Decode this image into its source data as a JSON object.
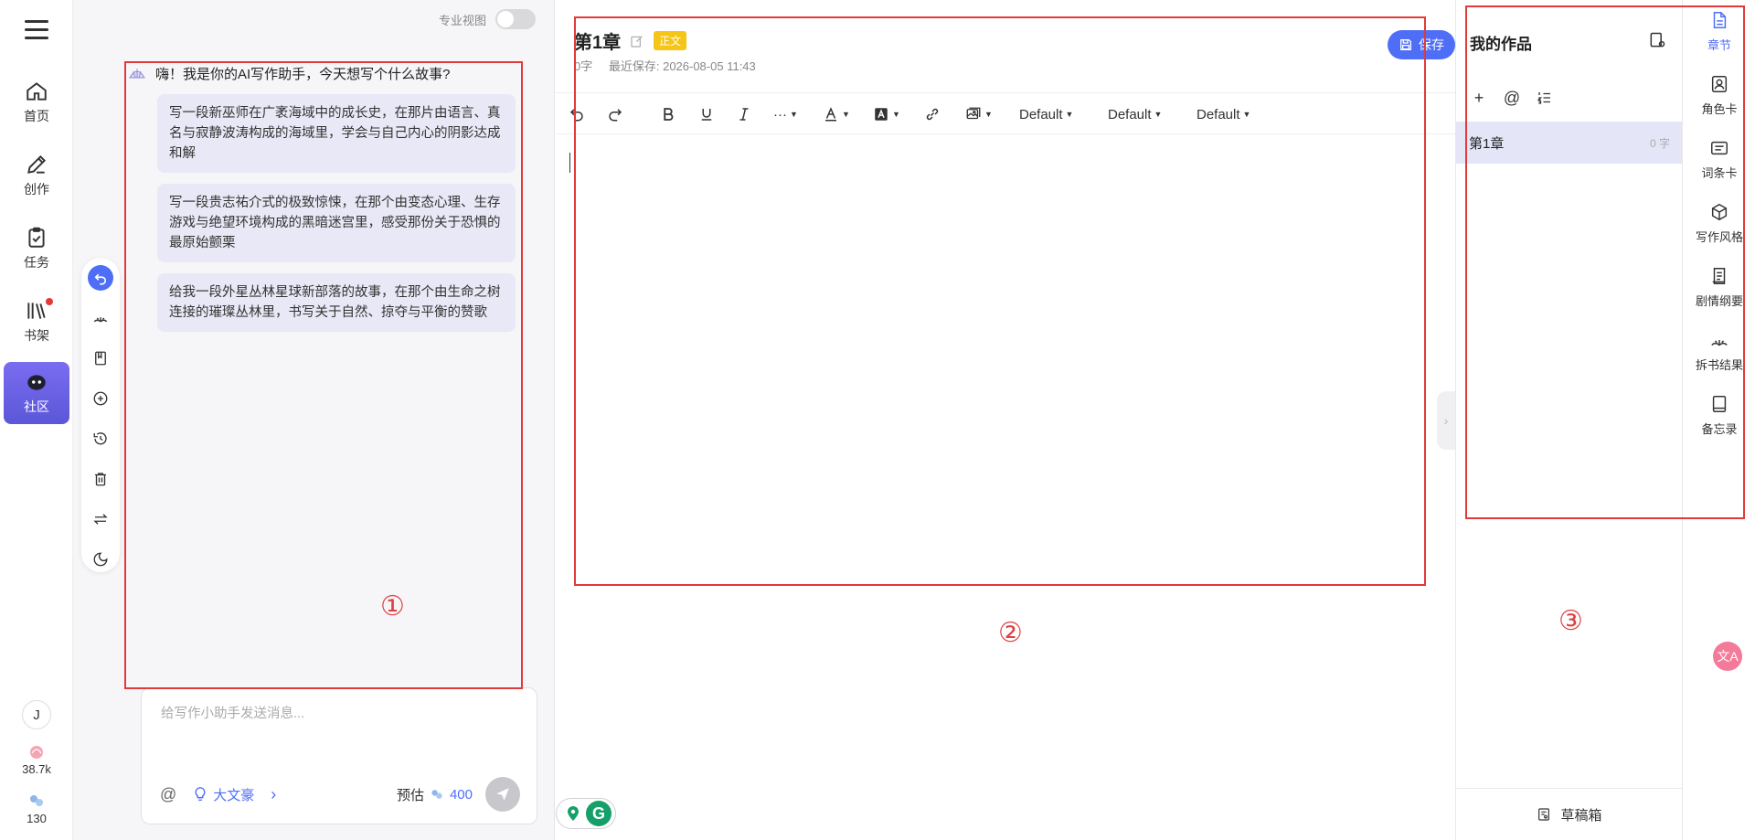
{
  "nav": {
    "items": [
      {
        "label": "首页",
        "icon": "home-icon"
      },
      {
        "label": "创作",
        "icon": "pen-icon"
      },
      {
        "label": "任务",
        "icon": "clipboard-icon"
      },
      {
        "label": "书架",
        "icon": "bookshelf-icon"
      },
      {
        "label": "社区",
        "icon": "discord-icon"
      }
    ],
    "avatar_letter": "J",
    "stat_shells": "38.7k",
    "stat_drops": "130"
  },
  "assistant": {
    "pro_view_label": "专业视图",
    "greeting": "嗨！我是你的AI写作助手，今天想写个什么故事?",
    "suggestions": [
      "写一段新巫师在广袤海域中的成长史，在那片由语言、真名与寂静波涛构成的海域里，学会与自己内心的阴影达成和解",
      "写一段贵志祐介式的极致惊悚，在那个由变态心理、生存游戏与绝望环境构成的黑暗迷宫里，感受那份关于恐惧的最原始颤栗",
      "给我一段外星丛林星球新部落的故事，在那个由生命之树连接的璀璨丛林里，书写关于自然、掠夺与平衡的赞歌"
    ],
    "input_placeholder": "给写作小助手发送消息...",
    "at_symbol": "@",
    "mode_label": "大文豪",
    "estimate_label": "预估",
    "estimate_value": "400",
    "annotation": "①"
  },
  "editor": {
    "chapter_title": "第1章",
    "badge": "正文",
    "word_count": "0字",
    "last_saved": "最近保存: 2026-08-05 11:43",
    "save_label": "保存",
    "font_selects": [
      "Default",
      "Default",
      "Default"
    ],
    "annotation": "②",
    "grammarly_letter": "G"
  },
  "works": {
    "title": "我的作品",
    "chapters": [
      {
        "title": "第1章",
        "words": "0 字"
      }
    ],
    "drafts_label": "草稿箱",
    "annotation": "③"
  },
  "rail": {
    "items": [
      {
        "label": "章节",
        "icon": "document-icon",
        "active": true
      },
      {
        "label": "角色卡",
        "icon": "portrait-icon"
      },
      {
        "label": "词条卡",
        "icon": "card-icon"
      },
      {
        "label": "写作风格",
        "icon": "cube-icon"
      },
      {
        "label": "剧情纲要",
        "icon": "outline-icon"
      },
      {
        "label": "拆书结果",
        "icon": "split-book-icon"
      },
      {
        "label": "备忘录",
        "icon": "notebook-icon"
      }
    ]
  },
  "colors": {
    "accent": "#4f6ef7",
    "nav_active": "#6a62e6",
    "badge": "#f5c518",
    "annotation_red": "#e03a3a"
  }
}
